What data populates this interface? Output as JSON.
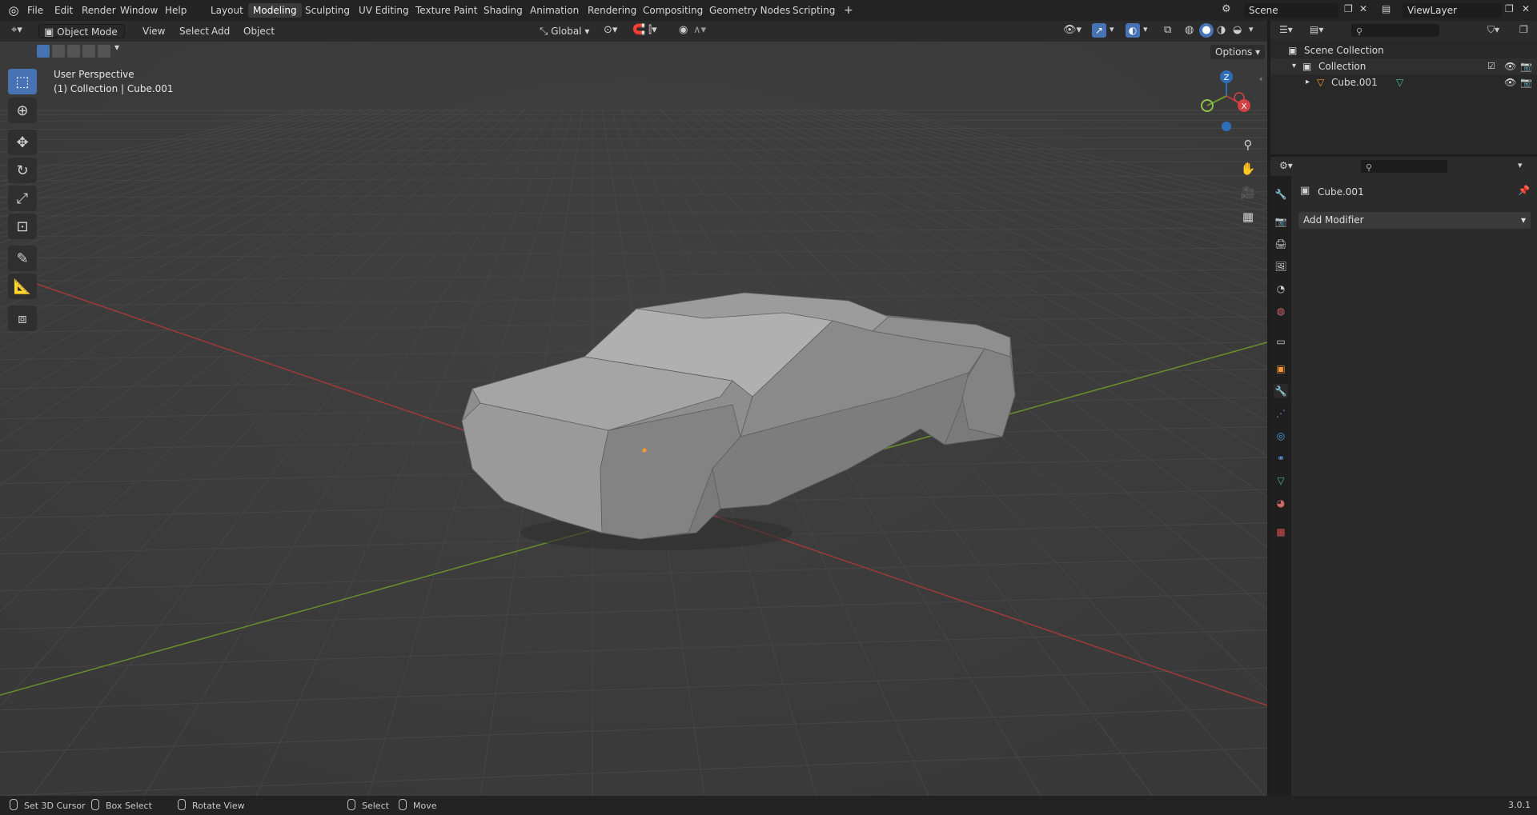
{
  "topbar": {
    "menus": [
      "File",
      "Edit",
      "Render",
      "Window",
      "Help"
    ],
    "workspaces": [
      "Layout",
      "Modeling",
      "Sculpting",
      "UV Editing",
      "Texture Paint",
      "Shading",
      "Animation",
      "Rendering",
      "Compositing",
      "Geometry Nodes",
      "Scripting"
    ],
    "active_workspace": "Modeling",
    "add_tab": "+",
    "scene": "Scene",
    "view_layer": "ViewLayer"
  },
  "viewport_header": {
    "mode": "Object Mode",
    "menus": [
      "View",
      "Select",
      "Add",
      "Object"
    ],
    "transform_orientation": "Global",
    "options": "Options"
  },
  "overlay": {
    "view_name": "User Perspective",
    "collection_info": "(1) Collection | Cube.001"
  },
  "gizmo": {
    "z": "Z",
    "x": "X"
  },
  "outliner": {
    "root": "Scene Collection",
    "collection": "Collection",
    "object": "Cube.001"
  },
  "properties": {
    "object_name": "Cube.001",
    "add_modifier": "Add Modifier",
    "active_tab": "modifier"
  },
  "status": {
    "left_click": "Set 3D Cursor",
    "box_select": "Box Select",
    "rotate": "Rotate View",
    "select": "Select",
    "move": "Move",
    "version": "3.0.1"
  },
  "colors": {
    "accent": "#4772b3",
    "x_axis": "#b33a3a",
    "y_axis": "#6f9a2c",
    "z_axis": "#2f6fb8",
    "origin": "#f59a2a"
  }
}
